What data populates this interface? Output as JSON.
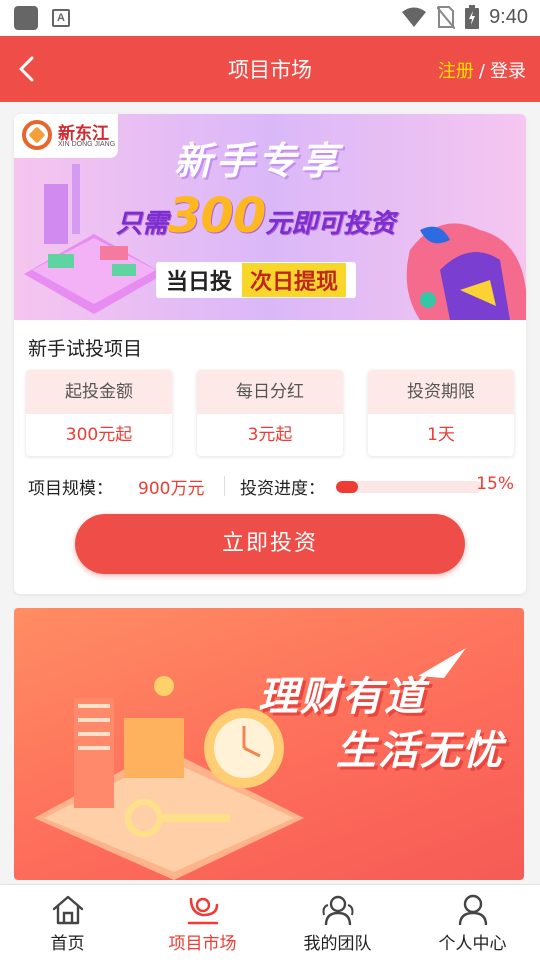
{
  "status_bar": {
    "time": "9:40"
  },
  "header": {
    "title": "项目市场",
    "register": "注册",
    "separator": "/",
    "login": "登录"
  },
  "banner_top": {
    "logo_name": "新东江",
    "logo_sub": "XIN DONG JIANG",
    "headline": "新手专享",
    "sub_prefix": "只需",
    "sub_amount": "300",
    "sub_suffix": "元即可投资",
    "tag_left": "当日投",
    "tag_right": "次日提现"
  },
  "project": {
    "title": "新手试投项目",
    "stats": [
      {
        "label": "起投金额",
        "value": "300元起"
      },
      {
        "label": "每日分红",
        "value": "3元起"
      },
      {
        "label": "投资期限",
        "value": "1天"
      }
    ],
    "scale_label": "项目规模：",
    "scale_value": "900万元",
    "progress_label": "投资进度：",
    "progress_value": "15%",
    "progress_fraction": 0.15,
    "invest_button": "立即投资"
  },
  "banner_bottom": {
    "line1": "理财有道",
    "line2": "生活无忧"
  },
  "bottom_nav": [
    {
      "label": "首页",
      "icon": "home-icon",
      "active": false
    },
    {
      "label": "项目市场",
      "icon": "market-icon",
      "active": true
    },
    {
      "label": "我的团队",
      "icon": "team-icon",
      "active": false
    },
    {
      "label": "个人中心",
      "icon": "user-icon",
      "active": false
    }
  ],
  "colors": {
    "brand_red": "#ef4e48",
    "accent_yellow": "#ffe100",
    "value_red": "#ee3c34"
  }
}
